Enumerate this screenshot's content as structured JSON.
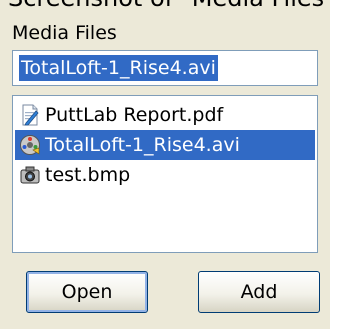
{
  "caption": "Screenshot of \"Media Files\"",
  "panel": {
    "label": "Media Files",
    "filename_value": "TotalLoft-1_Rise4.avi"
  },
  "files": [
    {
      "name": "PuttLab Report.pdf",
      "icon": "pdf-document-icon",
      "selected": false
    },
    {
      "name": "TotalLoft-1_Rise4.avi",
      "icon": "video-file-icon",
      "selected": true
    },
    {
      "name": "test.bmp",
      "icon": "camera-image-icon",
      "selected": false
    }
  ],
  "buttons": {
    "open_label": "Open",
    "add_label": "Add"
  },
  "colors": {
    "selection": "#316ac5",
    "panel_background": "#ece9d8",
    "field_border": "#7f9db9"
  }
}
